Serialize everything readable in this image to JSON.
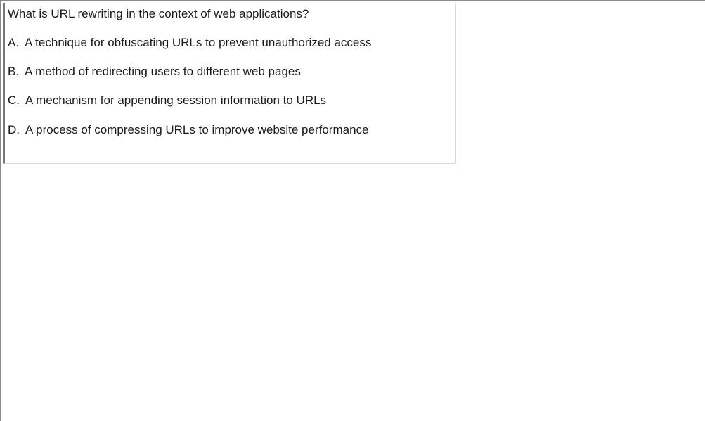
{
  "question": {
    "text": "What is URL rewriting in the context of web applications?"
  },
  "options": [
    {
      "letter": "A.",
      "text": "A technique for obfuscating URLs to prevent unauthorized access"
    },
    {
      "letter": "B.",
      "text": "A method of redirecting users to different web pages"
    },
    {
      "letter": "C.",
      "text": "A mechanism for appending session information to URLs"
    },
    {
      "letter": "D.",
      "text": "A process of compressing URLs to improve website performance"
    }
  ]
}
